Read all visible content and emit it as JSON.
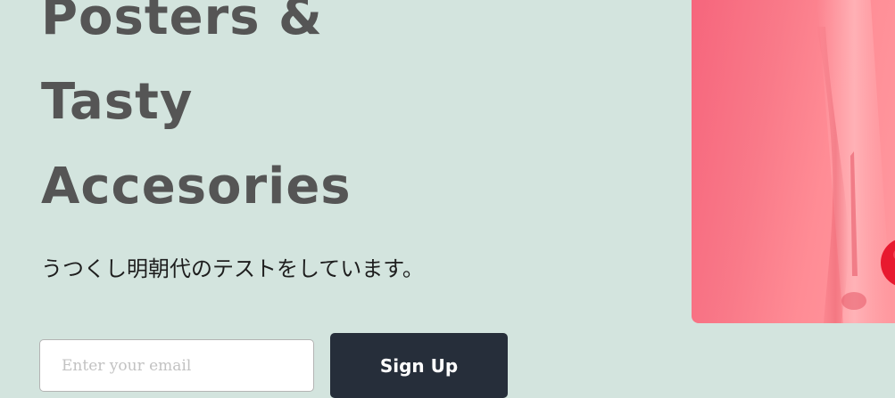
{
  "hero": {
    "heading_lines": [
      "Posters &",
      "Tasty",
      "Accesories"
    ],
    "subtitle": "うつくし明朝代のテストをしています。"
  },
  "signup": {
    "email_placeholder": "Enter your email",
    "button_label": "Sign Up"
  },
  "colors": {
    "background": "#d3e4de",
    "heading": "#555555",
    "button": "#262e3a",
    "image_accent": "#f6657c"
  }
}
